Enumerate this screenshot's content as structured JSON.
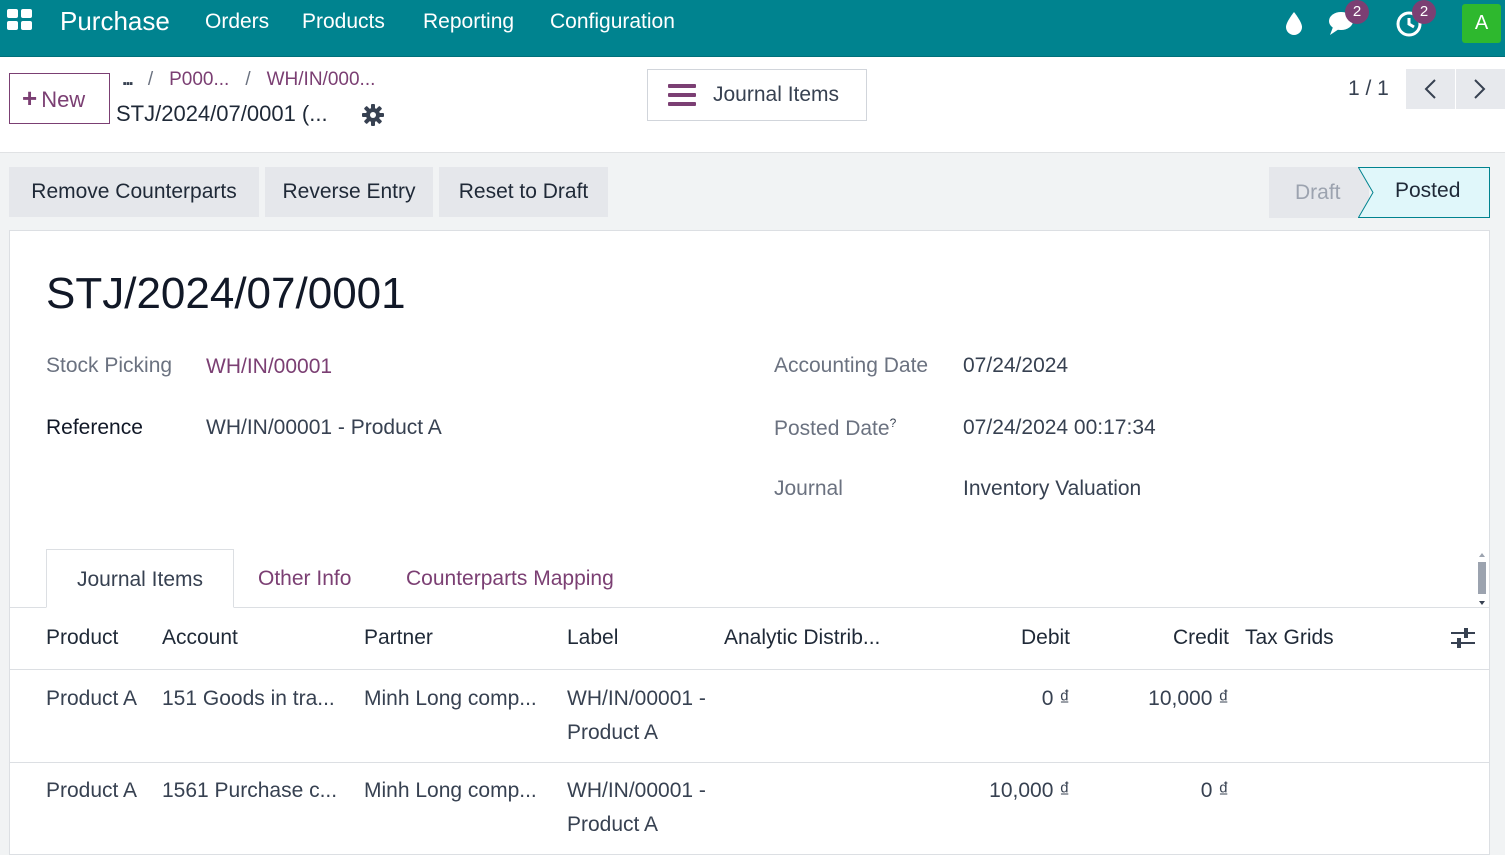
{
  "navbar": {
    "app_name": "Purchase",
    "menu": [
      "Orders",
      "Products",
      "Reporting",
      "Configuration"
    ],
    "messages_count": "2",
    "activities_count": "2",
    "avatar_letter": "A",
    "brand_color": "#00838f"
  },
  "control": {
    "new_label": "New",
    "breadcrumb": [
      "...",
      "P000...",
      "WH/IN/000..."
    ],
    "record_title": "STJ/2024/07/0001 (...",
    "journal_items_button": "Journal Items",
    "pager": "1 / 1"
  },
  "actions": {
    "remove_counterparts": "Remove Counterparts",
    "reverse_entry": "Reverse Entry",
    "reset_to_draft": "Reset to Draft"
  },
  "statusbar": {
    "states": [
      "Draft",
      "Posted"
    ],
    "current": "Posted"
  },
  "form": {
    "name": "STJ/2024/07/0001",
    "stock_picking_label": "Stock Picking",
    "stock_picking_value": "WH/IN/00001",
    "reference_label": "Reference",
    "reference_value": "WH/IN/00001 - Product A",
    "accounting_date_label": "Accounting Date",
    "accounting_date_value": "07/24/2024",
    "posted_date_label": "Posted Date",
    "posted_date_help": "?",
    "posted_date_value": "07/24/2024 00:17:34",
    "journal_label": "Journal",
    "journal_value": "Inventory Valuation"
  },
  "tabs": [
    "Journal Items",
    "Other Info",
    "Counterparts Mapping"
  ],
  "table": {
    "columns": [
      "Product",
      "Account",
      "Partner",
      "Label",
      "Analytic Distrib...",
      "Debit",
      "Credit",
      "Tax Grids"
    ],
    "rows": [
      {
        "product": "Product A",
        "account": "151 Goods in tra...",
        "partner": "Minh Long comp...",
        "label": "WH/IN/00001 - Product A",
        "analytic": "",
        "debit": "0 ₫",
        "credit": "10,000 ₫",
        "tax_grids": ""
      },
      {
        "product": "Product A",
        "account": "1561 Purchase c...",
        "partner": "Minh Long comp...",
        "label": "WH/IN/00001 - Product A",
        "analytic": "",
        "debit": "10,000 ₫",
        "credit": "0 ₫",
        "tax_grids": ""
      }
    ]
  }
}
